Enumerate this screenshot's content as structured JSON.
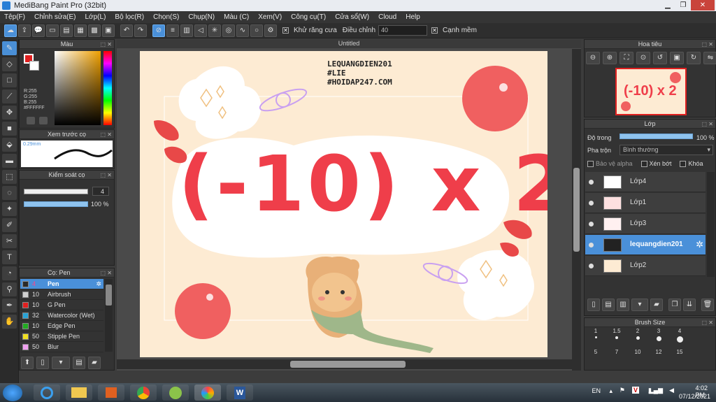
{
  "window": {
    "title": "MediBang Paint Pro (32bit)"
  },
  "menu": [
    "Tệp(F)",
    "Chỉnh sửa(E)",
    "Lớp(L)",
    "Bộ lọc(R)",
    "Chọn(S)",
    "Chụp(N)",
    "Màu (C)",
    "Xem(V)",
    "Công cụ(T)",
    "Cửa sổ(W)",
    "Cloud",
    "Help"
  ],
  "toolbar": {
    "antialias_label": "Khử răng cưa",
    "adjust_label": "Điều chỉnh",
    "adjust_value": "40",
    "snap_label": "Cạnh mềm"
  },
  "color_panel": {
    "title": "Màu",
    "r": "R:255",
    "g": "G:255",
    "b": "B:255",
    "hex": "#FFFFFF",
    "primary": "#e02020",
    "secondary": "#ffffff"
  },
  "preview_panel": {
    "title": "Xem trước cọ",
    "size": "0.29mm"
  },
  "brush_control": {
    "title": "Kiểm soát cọ",
    "size": "4",
    "opacity": "100 %",
    "opacity_fraction": 1.0
  },
  "brushes": {
    "title": "Cọ: Pen",
    "items": [
      {
        "size": "4",
        "name": "Pen",
        "color": "#2a2a2a",
        "selected": true
      },
      {
        "size": "10",
        "name": "Airbrush",
        "color": "#cfcfcf"
      },
      {
        "size": "10",
        "name": "G Pen",
        "color": "#e02020"
      },
      {
        "size": "32",
        "name": "Watercolor (Wet)",
        "color": "#29a3d6"
      },
      {
        "size": "10",
        "name": "Edge Pen",
        "color": "#22aa22"
      },
      {
        "size": "50",
        "name": "Stipple Pen",
        "color": "#f0e020"
      },
      {
        "size": "50",
        "name": "Blur",
        "color": "#f0a0f0"
      }
    ]
  },
  "document": {
    "tab": "Untitled"
  },
  "artwork": {
    "watermark_lines": [
      "LEQUANGDIEN201",
      "#LIE",
      "#HOIDAP247.COM"
    ],
    "expression": "(-10) x 2"
  },
  "navigator": {
    "title": "Hoa tiêu"
  },
  "layers": {
    "title": "Lớp",
    "opacity_label": "Độ trong",
    "opacity_value": "100 %",
    "opacity_fraction": 1.0,
    "blend_label": "Pha trộn",
    "blend_value": "Bình thường",
    "protect_alpha": "Bảo vệ alpha",
    "clipping": "Xén bớt",
    "lock": "Khóa",
    "items": [
      {
        "name": "Lớp4",
        "selected": false
      },
      {
        "name": "Lớp1",
        "selected": false
      },
      {
        "name": "Lớp3",
        "selected": false
      },
      {
        "name": "lequangdien201",
        "selected": true
      },
      {
        "name": "Lớp2",
        "selected": false
      }
    ]
  },
  "brush_size": {
    "title": "Brush Size",
    "rows": [
      [
        "1",
        "1.5",
        "2",
        "3",
        "4"
      ],
      [
        "5",
        "7",
        "10",
        "12",
        "15"
      ]
    ]
  },
  "taskbar": {
    "lang": "EN",
    "time": "4:02 PM",
    "date": "07/12/2021"
  }
}
